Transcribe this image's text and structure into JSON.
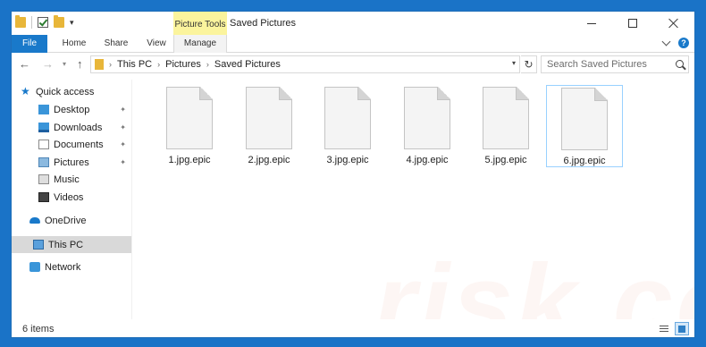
{
  "window": {
    "title": "Saved Pictures",
    "context_tab_group": "Picture Tools"
  },
  "quick_access_toolbar": {
    "dropdown_glyph": "▾"
  },
  "ribbon": {
    "tabs": [
      {
        "label": "File"
      },
      {
        "label": "Home"
      },
      {
        "label": "Share"
      },
      {
        "label": "View"
      },
      {
        "label": "Manage"
      }
    ],
    "help_glyph": "?"
  },
  "address": {
    "back_glyph": "←",
    "forward_glyph": "→",
    "up_glyph": "↑",
    "breadcrumbs": [
      "This PC",
      "Pictures",
      "Saved Pictures"
    ],
    "crumb_separator": "›",
    "refresh_glyph": "↻"
  },
  "search": {
    "placeholder": "Search Saved Pictures"
  },
  "navigation": {
    "quick_access_label": "Quick access",
    "items": [
      {
        "label": "Desktop",
        "icon": "desktop-icon",
        "pinned": true
      },
      {
        "label": "Downloads",
        "icon": "downloads-icon",
        "pinned": true
      },
      {
        "label": "Documents",
        "icon": "documents-icon",
        "pinned": true
      },
      {
        "label": "Pictures",
        "icon": "pictures-icon",
        "pinned": true
      },
      {
        "label": "Music",
        "icon": "music-icon",
        "pinned": false
      },
      {
        "label": "Videos",
        "icon": "videos-icon",
        "pinned": false
      }
    ],
    "onedrive_label": "OneDrive",
    "thispc_label": "This PC",
    "network_label": "Network",
    "pin_glyph": "📌"
  },
  "files": [
    {
      "name": "1.jpg.epic",
      "selected": false
    },
    {
      "name": "2.jpg.epic",
      "selected": false
    },
    {
      "name": "3.jpg.epic",
      "selected": false
    },
    {
      "name": "4.jpg.epic",
      "selected": false
    },
    {
      "name": "5.jpg.epic",
      "selected": false
    },
    {
      "name": "6.jpg.epic",
      "selected": true
    }
  ],
  "status": {
    "item_count": "6 items"
  },
  "watermark": "risk.com",
  "colors": {
    "accent": "#1979ca",
    "context_tab": "#fbf49d",
    "selection_border": "#99d1ff",
    "nav_selected": "#d9d9d9"
  }
}
